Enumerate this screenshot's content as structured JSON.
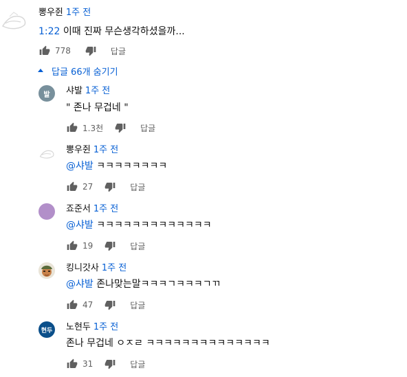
{
  "top_comment": {
    "author": "뽕우쥔",
    "time": "1주 전",
    "timestamp_link": "1:22",
    "text": " 이때 진짜 무슨생각하셨을까...",
    "likes": "778",
    "reply_label": "답글"
  },
  "toggle_replies": {
    "label": "답글 66개 숨기기"
  },
  "replies": [
    {
      "author": "샤발",
      "time": "1주 전",
      "avatar_text": "발",
      "avatar_color": "#78909c",
      "mention": "",
      "text": "\" 존나 무겁네 \"",
      "likes": "1.3천",
      "reply_label": "답글"
    },
    {
      "author": "뽕우쥔",
      "time": "1주 전",
      "mention": "@샤발",
      "text": " ㅋㅋㅋㅋㅋㅋㅋㅋ",
      "likes": "27",
      "reply_label": "답글"
    },
    {
      "author": "죠준서",
      "time": "1주 전",
      "avatar_color": "#b28fc9",
      "mention": "@샤발",
      "text": " ㅋㅋㅋㅋㅋㅋㅋㅋㅋㅋㅋㅋㅋ",
      "likes": "19",
      "reply_label": "답글"
    },
    {
      "author": "킹니갓사",
      "time": "1주 전",
      "mention": "@샤발",
      "text": " 존나맞는말ㅋㅋㅋㄱㅋㅋㅋㄱㄲ",
      "likes": "47",
      "reply_label": "답글"
    },
    {
      "author": "노현두",
      "time": "1주 전",
      "avatar_text": "현두",
      "avatar_color": "#0b4f8a",
      "mention": "",
      "text": "존나 무겁네 ㅇㅈㄹ ㅋㅋㅋㅋㅋㅋㅋㅋㅋㅋㅋㅋㅋㅋ",
      "likes": "31",
      "reply_label": "답글"
    }
  ],
  "colors": {
    "link": "#065fd4",
    "meta": "#606060",
    "text": "#0f0f0f"
  }
}
